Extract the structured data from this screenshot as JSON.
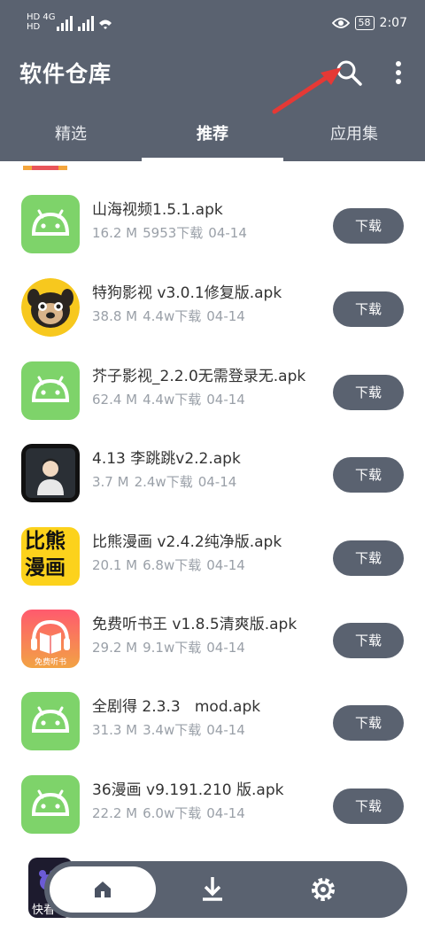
{
  "status_bar": {
    "left_top": "HD 4G",
    "left_bottom": "HD",
    "battery": "58",
    "time": "2:07"
  },
  "header": {
    "title": "软件仓库",
    "search_icon": "search-icon",
    "more_icon": "more-vert-icon"
  },
  "tabs": [
    {
      "label": "精选",
      "active": false
    },
    {
      "label": "推荐",
      "active": true
    },
    {
      "label": "应用集",
      "active": false
    }
  ],
  "apps": [
    {
      "name": "山海视频1.5.1.apk",
      "size": "16.2 M",
      "downloads": "5953下载",
      "date": "04-14",
      "icon": "android-icon",
      "button": "下载"
    },
    {
      "name": "特狗影视 v3.0.1修复版.apk",
      "size": "38.8 M",
      "downloads": "4.4w下载",
      "date": "04-14",
      "icon": "pug-icon",
      "button": "下载"
    },
    {
      "name": "芥子影视_2.2.0无需登录无.apk",
      "size": "62.4 M",
      "downloads": "4.4w下载",
      "date": "04-14",
      "icon": "android-icon",
      "button": "下载"
    },
    {
      "name": "4.13 李跳跳v2.2.apk",
      "size": "3.7 M",
      "downloads": "2.4w下载",
      "date": "04-14",
      "icon": "person-icon",
      "button": "下载"
    },
    {
      "name": "比熊漫画 v2.4.2纯净版.apk",
      "size": "20.1 M",
      "downloads": "6.8w下载",
      "date": "04-14",
      "icon": "bixiong-icon",
      "icon_text_1": "比熊",
      "icon_text_2": "漫画",
      "button": "下载"
    },
    {
      "name": "免费听书王 v1.8.5清爽版.apk",
      "size": "29.2 M",
      "downloads": "9.1w下载",
      "date": "04-14",
      "icon": "headphone-book-icon",
      "icon_text": "免费听书",
      "button": "下载"
    },
    {
      "name": "全剧得 2.3.3   mod.apk",
      "size": "31.3 M",
      "downloads": "3.4w下载",
      "date": "04-14",
      "icon": "android-icon",
      "button": "下载"
    },
    {
      "name": "36漫画 v9.191.210 版.apk",
      "size": "22.2 M",
      "downloads": "6.0w下载",
      "date": "04-14",
      "icon": "android-icon",
      "button": "下载"
    }
  ],
  "peek": {
    "text": "快看"
  },
  "bottom_nav": [
    {
      "name": "home-icon",
      "active": true
    },
    {
      "name": "download-icon",
      "active": false
    },
    {
      "name": "settings-icon",
      "active": false
    }
  ],
  "colors": {
    "primary": "#5a6270",
    "android_green": "#7ed36a",
    "accent_red": "#e53935"
  }
}
